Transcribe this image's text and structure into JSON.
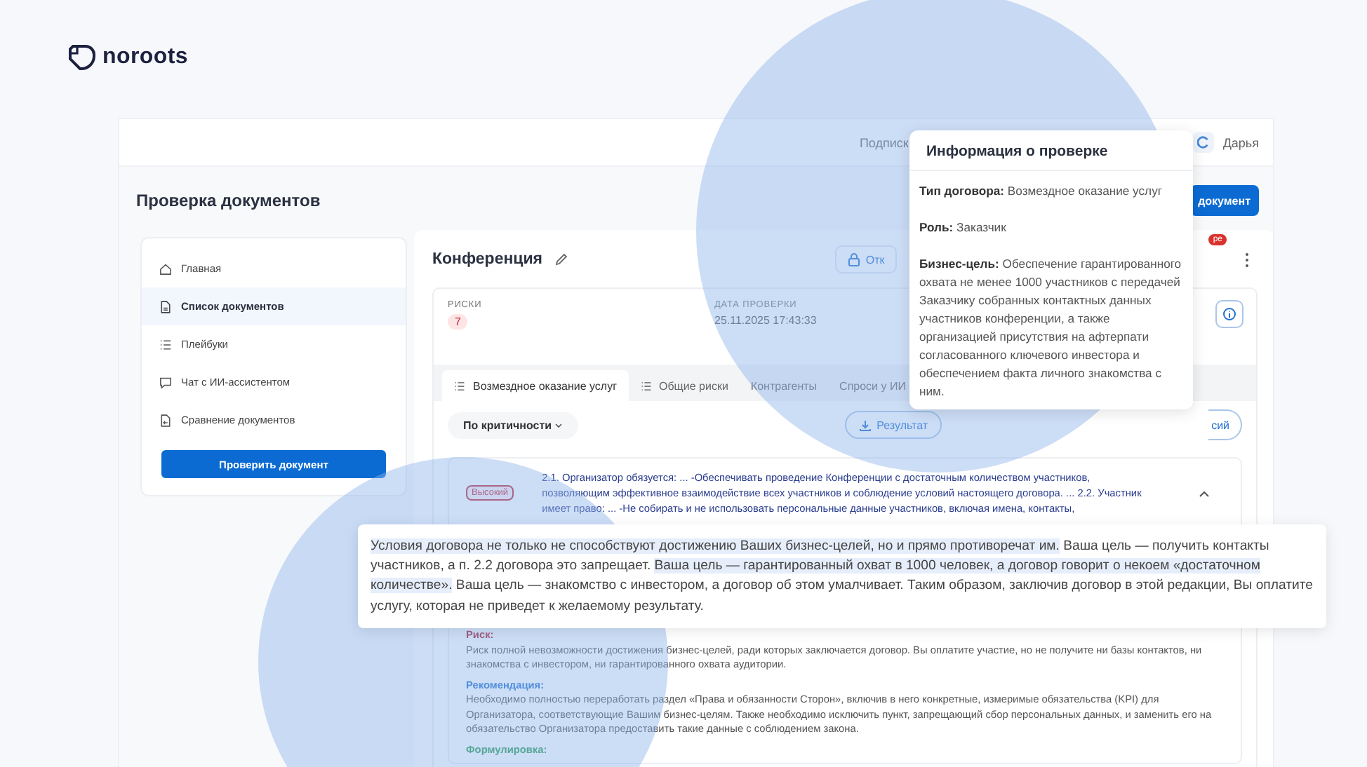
{
  "brand": {
    "name": "noroots"
  },
  "header": {
    "subscription_text": "Подписк",
    "user_name": "Дарья"
  },
  "page_title": "Проверка документов",
  "primary_button": "документ",
  "sidebar": {
    "items": [
      {
        "label": "Главная",
        "selected": false
      },
      {
        "label": "Список документов",
        "selected": true
      },
      {
        "label": "Плейбуки",
        "selected": false
      },
      {
        "label": "Чат с ИИ-ассистентом",
        "selected": false
      },
      {
        "label": "Сравнение документов",
        "selected": false
      }
    ],
    "button": "Проверить документ"
  },
  "document": {
    "title": "Конференция",
    "open_button": "Отк",
    "badge": "ре",
    "stats": [
      {
        "label": "РИСКИ",
        "value": "7",
        "kind": "badge"
      },
      {
        "label": "ДАТА ПРОВЕРКИ",
        "value": "25.11.2025 17:43:33",
        "kind": "text"
      }
    ],
    "tabs": [
      {
        "label": "Возмездное оказание услуг",
        "with_icon": true,
        "selected": true
      },
      {
        "label": "Общие риски",
        "with_icon": true,
        "selected": false
      },
      {
        "label": "Контрагенты",
        "with_icon": false,
        "selected": false
      },
      {
        "label": "Спроси у ИИ",
        "with_icon": false,
        "selected": false
      }
    ],
    "filter": "По критичности",
    "results_button": "Результат",
    "versions_button": "сий",
    "risk": {
      "severity": "Высокий",
      "clause": "2.1. Организатор обязуется: ... -Обеспечивать проведение Конференции с достаточным количеством участников, позволяющим эффективное взаимодействие всех участников и соблюдение условий настоящего договора. ... 2.2. Участник имеет право: ... -Не собирать и не использовать персональные данные участников, включая имена, контакты,",
      "sections": [
        {
          "kind": "risk",
          "title": "Риск:",
          "text": "Риск полной невозможности достижения бизнес-целей, ради которых заключается договор. Вы оплатите участие, но не получите ни базы контактов, ни знакомства с инвестором, ни гарантированного охвата аудитории."
        },
        {
          "kind": "recommendation",
          "title": "Рекомендация:",
          "text": "Необходимо полностью переработать раздел «Права и обязанности Сторон», включив в него конкретные, измеримые обязательства (KPI) для Организатора, соответствующие Вашим бизнес-целям. Также необходимо исключить пункт, запрещающий сбор персональных данных, и заменить его на обязательство Организатора предоставить такие данные с соблюдением закона."
        },
        {
          "kind": "wording",
          "title": "Формулировка:"
        }
      ]
    }
  },
  "info_popup": {
    "title": "Информация о проверке",
    "fields": [
      "**Тип договора:** Возмездное оказание услуг",
      "**Роль:** Заказчик",
      "**Бизнес-цель:** Обеспечение гарантированного охвата не менее 1000 участников с передачей Заказчику собранных контактных данных участников конференции, а также организацией присутствия на афтерпати согласованного ключевого инвестора и обеспечением факта личного знакомства с ним."
    ]
  },
  "ai_callout": {
    "segments": [
      {
        "text": "Условия договора не только не способствуют достижению Ваших бизнес-целей, но и прямо противоречат им.",
        "highlighted": true
      },
      {
        "text": "Ваша цель — получить контакты участников, а п. 2.2 договора это запрещает.",
        "highlighted": false
      },
      {
        "text": "Ваша цель — гарантированный охват в 1000 человек, а договор говорит о некоем «достаточном количестве».",
        "highlighted": true
      },
      {
        "text": "Ваша цель — знакомство с инвестором, а договор об этом умалчивает. Таким образом, заключив договор в этой редакции, Вы оплатите услугу, которая не приведет к желаемому результату.",
        "highlighted": false
      }
    ]
  }
}
